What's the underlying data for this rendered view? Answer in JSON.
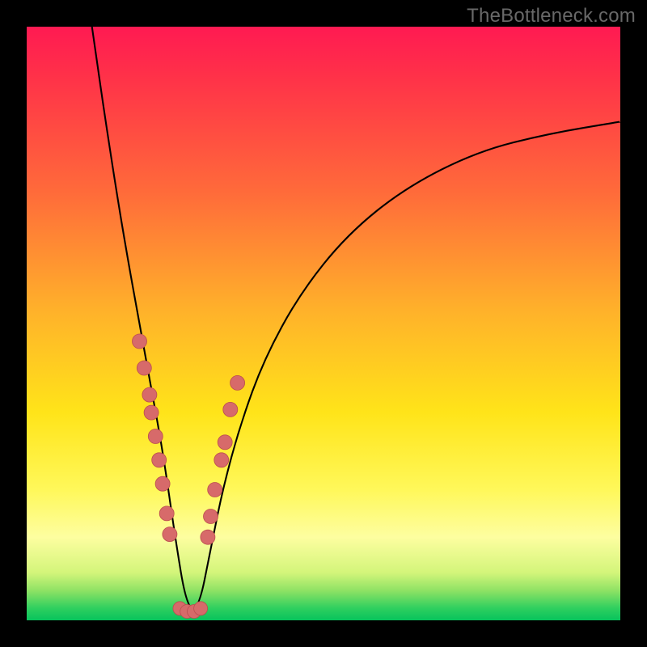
{
  "watermark": "TheBottleneck.com",
  "colors": {
    "frame": "#000000",
    "curve": "#000000",
    "dot_fill": "#d76a6a",
    "dot_stroke": "#bb4e4e",
    "gradient_stops": [
      "#ff1a52",
      "#ff6b3a",
      "#ffb22a",
      "#ffe419",
      "#fdfea0",
      "#8ee264",
      "#07c35c"
    ]
  },
  "chart_data": {
    "type": "line",
    "title": "",
    "xlabel": "",
    "ylabel": "",
    "xlim": [
      0,
      100
    ],
    "ylim": [
      0,
      100
    ],
    "note": "Axes are unlabeled; values are pixel-proportional estimates on a 0–100 scale. Curve is a V-shaped bottleneck visualization with minimum near x≈27, y≈0.",
    "series": [
      {
        "name": "curve",
        "x": [
          11,
          13,
          15,
          17,
          19,
          21,
          23,
          25,
          27,
          29,
          31,
          33,
          36,
          40,
          46,
          54,
          64,
          76,
          88,
          100
        ],
        "y": [
          100,
          86,
          73,
          61,
          50,
          39,
          28,
          14,
          2,
          2,
          12,
          22,
          33,
          44,
          55,
          65,
          73,
          79,
          82,
          84
        ]
      },
      {
        "name": "dots-left-branch",
        "x": [
          19.0,
          19.8,
          20.7,
          21.0,
          21.7,
          22.3,
          22.9,
          23.6,
          24.1
        ],
        "y": [
          47.0,
          42.5,
          38.0,
          35.0,
          31.0,
          27.0,
          23.0,
          18.0,
          14.5
        ]
      },
      {
        "name": "dots-bottom",
        "x": [
          25.8,
          27.0,
          28.2,
          29.3
        ],
        "y": [
          2.0,
          1.5,
          1.5,
          2.0
        ]
      },
      {
        "name": "dots-right-branch",
        "x": [
          30.5,
          31.0,
          31.7,
          32.8,
          33.4,
          34.3,
          35.5
        ],
        "y": [
          14.0,
          17.5,
          22.0,
          27.0,
          30.0,
          35.5,
          40.0
        ]
      }
    ]
  }
}
